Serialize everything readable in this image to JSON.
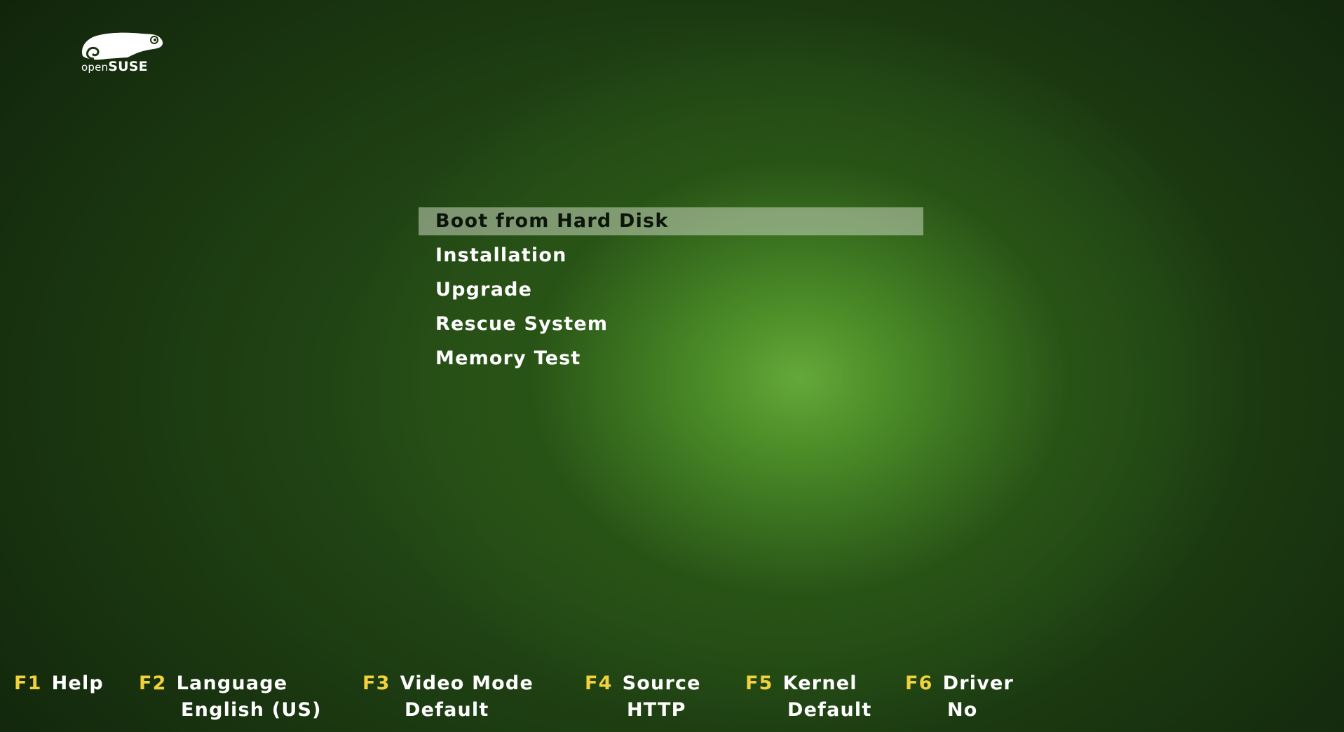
{
  "logo": {
    "open": "open",
    "suse": "SUSE",
    "icon": "chameleon-icon",
    "color": "#ffffff"
  },
  "menu": {
    "items": [
      {
        "label": "Boot from Hard Disk",
        "selected": true
      },
      {
        "label": "Installation",
        "selected": false
      },
      {
        "label": "Upgrade",
        "selected": false
      },
      {
        "label": "Rescue System",
        "selected": false
      },
      {
        "label": "Memory Test",
        "selected": false
      }
    ]
  },
  "fkeys": [
    {
      "key": "F1",
      "label": "Help",
      "value": ""
    },
    {
      "key": "F2",
      "label": "Language",
      "value": "English (US)"
    },
    {
      "key": "F3",
      "label": "Video Mode",
      "value": "Default"
    },
    {
      "key": "F4",
      "label": "Source",
      "value": "HTTP"
    },
    {
      "key": "F5",
      "label": "Kernel",
      "value": "Default"
    },
    {
      "key": "F6",
      "label": "Driver",
      "value": "No"
    }
  ],
  "colors": {
    "key": "#f2d23c",
    "text": "#ffffff",
    "selection": "#c8d6be",
    "background_glow": "#64a83a",
    "background_dark": "#0f1f0c"
  }
}
